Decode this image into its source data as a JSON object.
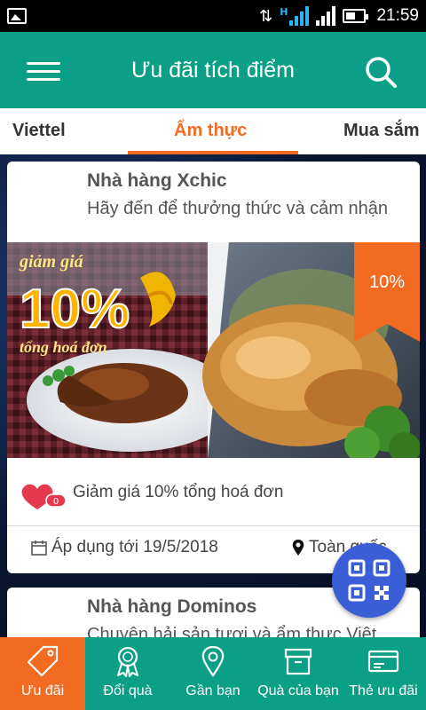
{
  "status_bar": {
    "time": "21:59",
    "network_type": "H"
  },
  "app_bar": {
    "title": "Ưu đãi tích điểm"
  },
  "tabs": [
    {
      "label": "Viettel"
    },
    {
      "label": "Ẩm thực"
    },
    {
      "label": "Mua sắm"
    }
  ],
  "active_tab": "Ẩm thực",
  "offers": [
    {
      "name": "Nhà hàng Xchic",
      "subtitle": "Hãy đến để thưởng thức và  cảm nhận",
      "badge": "10%",
      "image_text": {
        "line1": "giảm giá",
        "line2": "10%",
        "line3": "tổng hoá đơn"
      },
      "like_count": "0",
      "deal": "Giảm giá 10% tổng hoá đơn",
      "valid_until": "Áp dụng tới 19/5/2018",
      "location": "Toàn quốc"
    },
    {
      "name": "Nhà hàng Dominos",
      "subtitle": "Chuyên hải sản tươi và ẩm thực Việt"
    }
  ],
  "bottom_nav": [
    {
      "label": "Ưu đãi",
      "icon": "tag-icon"
    },
    {
      "label": "Đổi quà",
      "icon": "award-icon"
    },
    {
      "label": "Gần bạn",
      "icon": "location-pin-icon"
    },
    {
      "label": "Quà của bạn",
      "icon": "gift-box-icon"
    },
    {
      "label": "Thẻ ưu đãi",
      "icon": "card-icon"
    }
  ],
  "colors": {
    "primary": "#0a9f86",
    "accent": "#f36b21",
    "fab": "#3a5ed6"
  }
}
